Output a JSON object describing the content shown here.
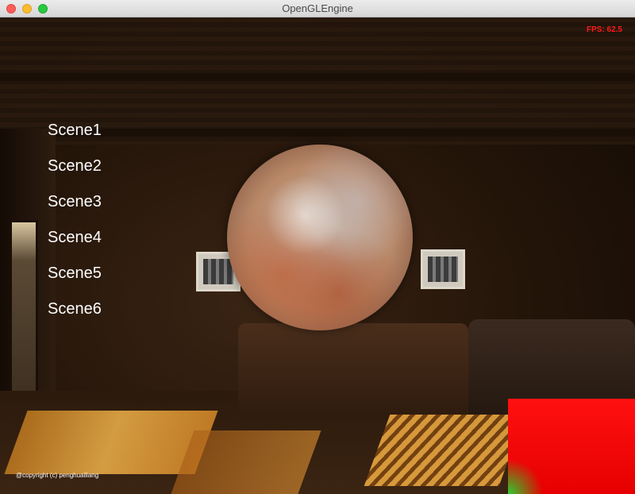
{
  "window": {
    "title": "OpenGLEngine"
  },
  "scenes": [
    {
      "label": "Scene1"
    },
    {
      "label": "Scene2"
    },
    {
      "label": "Scene3"
    },
    {
      "label": "Scene4"
    },
    {
      "label": "Scene5"
    },
    {
      "label": "Scene6"
    }
  ],
  "hud": {
    "fps": "FPS: 62.5",
    "copyright": "@copyright (c) penghuailiang"
  },
  "colors": {
    "fps_text": "#ff1a1a",
    "menu_text": "#ffffff",
    "debug_quad": "#e60000"
  }
}
